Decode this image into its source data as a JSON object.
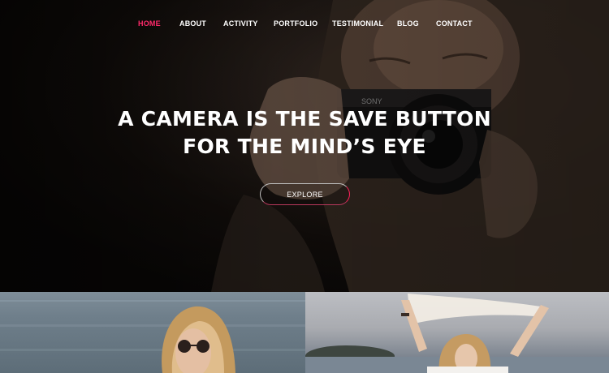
{
  "nav": {
    "items": [
      {
        "label": "HOME",
        "active": true
      },
      {
        "label": "ABOUT",
        "active": false
      },
      {
        "label": "ACTIVITY",
        "active": false
      },
      {
        "label": "PORTFOLIO",
        "active": false
      },
      {
        "label": "TESTIMONIAL",
        "active": false
      },
      {
        "label": "BLOG",
        "active": false
      },
      {
        "label": "CONTACT",
        "active": false
      }
    ]
  },
  "hero": {
    "headline_line1": "A CAMERA IS THE SAVE BUTTON",
    "headline_line2": "FOR THE MIND’S EYE",
    "cta_label": "EXPLORE"
  },
  "colors": {
    "accent": "#ff2a6a",
    "nav_text": "#ffffff",
    "hero_dark": "#0a0807"
  },
  "gallery": {
    "tiles": [
      {
        "subject": "woman-with-sunglasses-by-sea"
      },
      {
        "subject": "woman-holding-scarf-by-sea"
      }
    ]
  }
}
